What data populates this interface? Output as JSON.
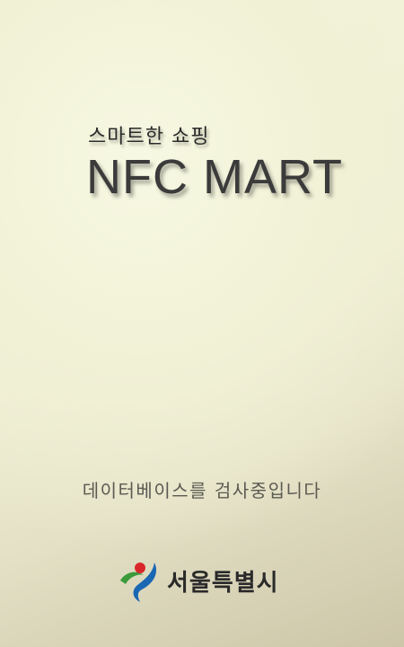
{
  "splash": {
    "tagline": "스마트한 쇼핑",
    "app_title": "NFC MART",
    "status_text": "데이터베이스를 검사중입니다",
    "logo": {
      "icon": "seoul-city-symbol-icon",
      "text": "서울특별시",
      "colors": {
        "red": "#d9262b",
        "green": "#3c9a3a",
        "blue": "#1a67b3"
      }
    }
  }
}
